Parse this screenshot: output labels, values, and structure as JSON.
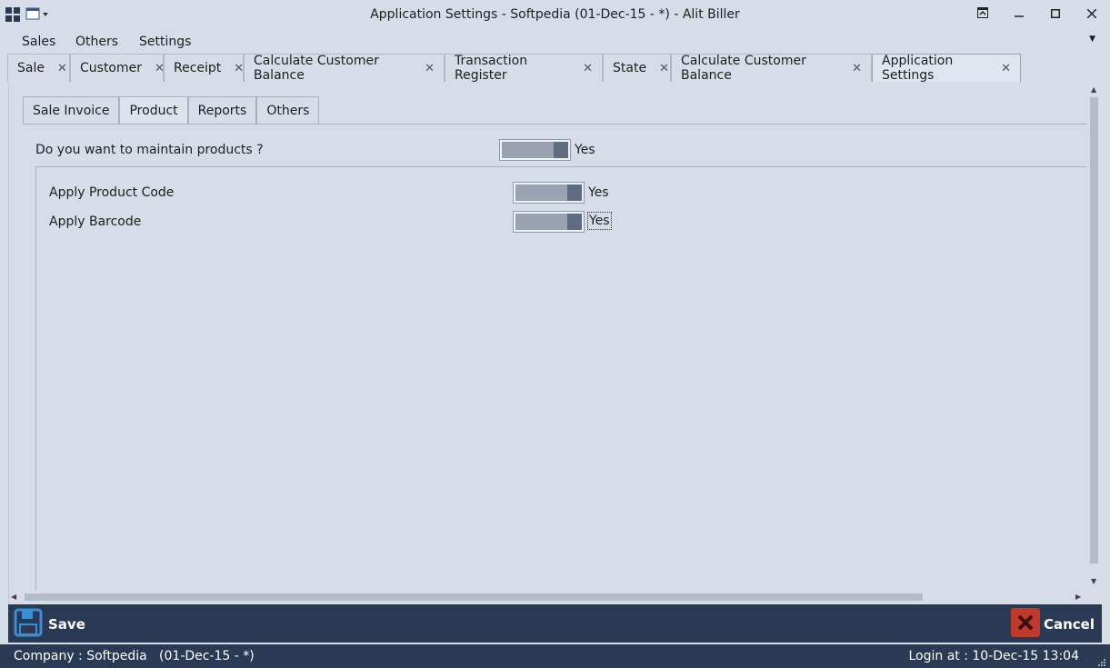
{
  "window": {
    "title": "Application Settings - Softpedia (01-Dec-15 - *) - Alit Biller"
  },
  "menu": {
    "items": [
      "Sales",
      "Others",
      "Settings"
    ]
  },
  "doc_tabs": [
    {
      "label": "Sale"
    },
    {
      "label": "Customer"
    },
    {
      "label": "Receipt"
    },
    {
      "label": "Calculate Customer Balance"
    },
    {
      "label": "Transaction Register"
    },
    {
      "label": "State"
    },
    {
      "label": "Calculate Customer Balance"
    },
    {
      "label": "Application Settings"
    }
  ],
  "sub_tabs": [
    "Sale Invoice",
    "Product",
    "Reports",
    "Others"
  ],
  "settings": {
    "maintain_products": {
      "label": "Do you want to maintain products ?",
      "value": "Yes"
    },
    "apply_product_code": {
      "label": "Apply Product Code",
      "value": "Yes"
    },
    "apply_barcode": {
      "label": "Apply Barcode",
      "value": "Yes"
    }
  },
  "actions": {
    "save_label": "Save",
    "cancel_label": "Cancel"
  },
  "status": {
    "company": "Company : Softpedia   (01-Dec-15 - *)",
    "login": "Login at : 10-Dec-15 13:04"
  },
  "colors": {
    "background": "#d6dde8",
    "bar": "#2a3a55",
    "toggle_on": "#5f6c82",
    "cancel_red": "#c0392b",
    "save_blue": "#3a8fd6"
  }
}
